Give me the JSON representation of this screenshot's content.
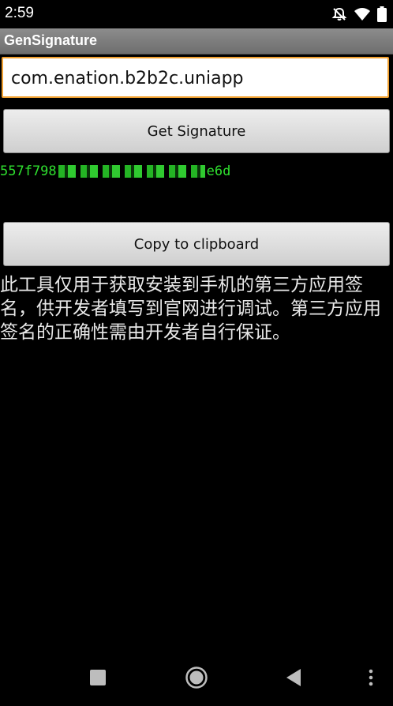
{
  "status_bar": {
    "time": "2:59",
    "icons": [
      "do-not-disturb-icon",
      "wifi-icon",
      "battery-icon"
    ]
  },
  "app_bar": {
    "title": "GenSignature"
  },
  "form": {
    "package_value": "com.enation.b2b2c.uniapp",
    "get_signature_label": "Get Signature",
    "signature_prefix": "557f798",
    "signature_suffix": "e6d",
    "copy_label": "Copy to clipboard"
  },
  "info": {
    "text": "此工具仅用于获取安装到手机的第三方应用签名，供开发者填写到官网进行调试。第三方应用签名的正确性需由开发者自行保证。"
  },
  "nav_bar": {
    "buttons": [
      "recents-icon",
      "home-icon",
      "back-icon",
      "overflow-menu-icon"
    ]
  },
  "colors": {
    "accent_border": "#f0a030",
    "signature_green": "#2fe02f",
    "background": "#000000"
  }
}
